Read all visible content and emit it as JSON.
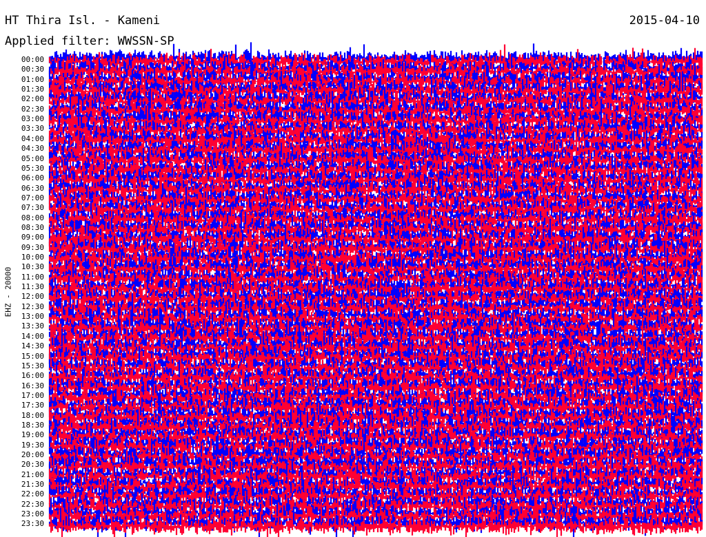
{
  "header": {
    "station": "HT Thira Isl. - Kameni",
    "date": "2015-04-10",
    "filter": "Applied filter: WWSSN-SP"
  },
  "axis": {
    "channel": "EHZ - 20000",
    "time_labels": [
      "00:00",
      "00:30",
      "01:00",
      "01:30",
      "02:00",
      "02:30",
      "03:00",
      "03:30",
      "04:00",
      "04:30",
      "05:00",
      "05:30",
      "06:00",
      "06:30",
      "07:00",
      "07:30",
      "08:00",
      "08:30",
      "09:00",
      "09:30",
      "10:00",
      "10:30",
      "11:00",
      "11:30",
      "12:00",
      "12:30",
      "13:00",
      "13:30",
      "14:00",
      "14:30",
      "15:00",
      "15:30",
      "16:00",
      "16:30",
      "17:00",
      "17:30",
      "18:00",
      "18:30",
      "19:00",
      "19:30",
      "20:00",
      "20:30",
      "21:00",
      "21:30",
      "22:00",
      "22:30",
      "23:00",
      "23:30"
    ]
  },
  "colors": {
    "trace_a": "#0000ff",
    "trace_b": "#ff0033",
    "background": "#ffffff",
    "text": "#000000"
  }
}
